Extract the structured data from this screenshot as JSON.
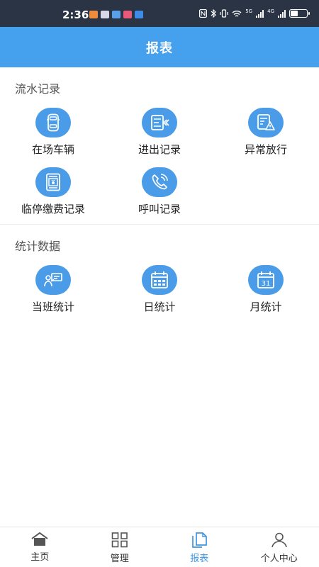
{
  "status_bar": {
    "time": "2:36",
    "network_5g": "5G",
    "network_4g": "4G",
    "battery_level": 0.45
  },
  "header": {
    "title": "报表"
  },
  "sections": [
    {
      "title": "流水记录",
      "items": [
        {
          "label": "在场车辆",
          "icon": "car-icon"
        },
        {
          "label": "进出记录",
          "icon": "entry-exit-list-icon"
        },
        {
          "label": "异常放行",
          "icon": "warning-list-icon"
        },
        {
          "label": "临停缴费记录",
          "icon": "payment-receipt-icon"
        },
        {
          "label": "呼叫记录",
          "icon": "phone-call-icon"
        }
      ]
    },
    {
      "title": "统计数据",
      "items": [
        {
          "label": "当班统计",
          "icon": "shift-stats-icon"
        },
        {
          "label": "日统计",
          "icon": "calendar-day-icon"
        },
        {
          "label": "月统计",
          "icon": "calendar-month-icon"
        }
      ],
      "month_badge": "31"
    }
  ],
  "tab_bar": {
    "tabs": [
      {
        "label": "主页",
        "icon": "home-icon",
        "active": false
      },
      {
        "label": "管理",
        "icon": "grid-icon",
        "active": false
      },
      {
        "label": "报表",
        "icon": "report-icon",
        "active": true
      },
      {
        "label": "个人中心",
        "icon": "person-icon",
        "active": false
      }
    ]
  },
  "colors": {
    "header": "#45a0ee",
    "icon_circle": "#4a9ce9",
    "status_bar": "#2a3444",
    "tab_active": "#3f95e4"
  }
}
